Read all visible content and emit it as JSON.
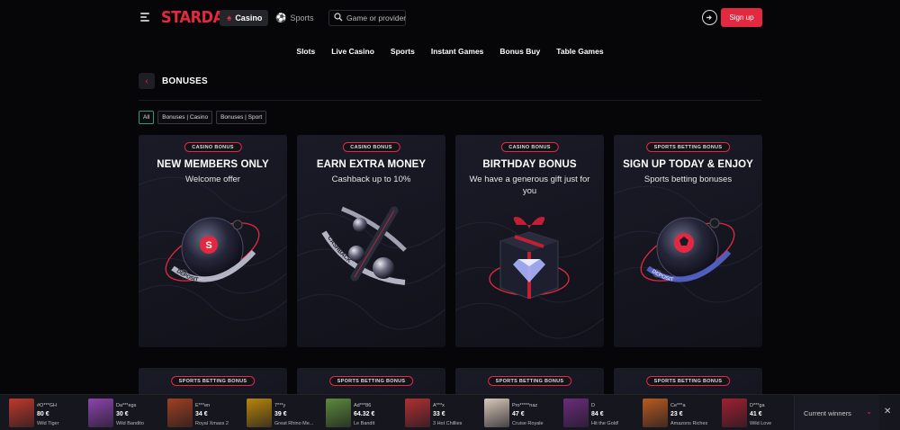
{
  "header": {
    "logo": "STARDA",
    "tabs": [
      {
        "label": "Casino",
        "icon": "spade-icon",
        "active": true
      },
      {
        "label": "Sports",
        "icon": "ball-icon",
        "active": false
      }
    ],
    "search_placeholder": "Game or provider",
    "signup_label": "Sign up"
  },
  "nav": [
    "Slots",
    "Live Casino",
    "Sports",
    "Instant Games",
    "Bonus Buy",
    "Table Games"
  ],
  "page": {
    "title": "BONUSES",
    "filters": [
      {
        "label": "All",
        "active": true
      },
      {
        "label": "Bonuses | Casino",
        "active": false
      },
      {
        "label": "Bonuses | Sport",
        "active": false
      }
    ]
  },
  "cards": [
    {
      "badge": "CASINO BONUS",
      "title": "NEW MEMBERS ONLY",
      "subtitle": "Welcome offer",
      "art_text": "DEPOSIT",
      "art_letter": "S"
    },
    {
      "badge": "CASINO BONUS",
      "title": "EARN EXTRA MONEY",
      "subtitle": "Cashback up to 10%",
      "art_text": "CASHBACK"
    },
    {
      "badge": "CASINO BONUS",
      "title": "BIRTHDAY BONUS",
      "subtitle": "We have a generous gift just for you"
    },
    {
      "badge": "SPORTS BETTING BONUS",
      "title": "SIGN UP TODAY & ENJOY",
      "subtitle": "Sports betting bonuses",
      "art_text": "DEPOSIT"
    }
  ],
  "cards_row2": [
    {
      "badge": "SPORTS BETTING BONUS"
    },
    {
      "badge": "SPORTS BETTING BONUS"
    },
    {
      "badge": "SPORTS BETTING BONUS"
    },
    {
      "badge": "SPORTS BETTING BONUS"
    }
  ],
  "winners": {
    "items": [
      {
        "user": "#O***GH",
        "amount": "80 €",
        "game": "Wild Tiger",
        "color": "#c0392b"
      },
      {
        "user": "Da***egs",
        "amount": "30 €",
        "game": "Wild Bandito",
        "color": "#8e44ad"
      },
      {
        "user": "E***en",
        "amount": "34 €",
        "game": "Royal Xmass 2",
        "color": "#a04020"
      },
      {
        "user": "7***y",
        "amount": "39 €",
        "game": "Great Rhino Me...",
        "color": "#b8860b"
      },
      {
        "user": "Ad***86",
        "amount": "64.32 €",
        "game": "Le Bandit",
        "color": "#5d8a3a"
      },
      {
        "user": "A***x",
        "amount": "33 €",
        "game": "3 Hot Chillies",
        "color": "#b03030"
      },
      {
        "user": "Pro*****naz",
        "amount": "47 €",
        "game": "Cruise Royale",
        "color": "#d8c8b8"
      },
      {
        "user": "D",
        "amount": "84 €",
        "game": "Hit the Gold!",
        "color": "#6b2c7a"
      },
      {
        "user": "Ce***a",
        "amount": "23 €",
        "game": "Amazons Riches",
        "color": "#b85a20"
      },
      {
        "user": "D***ga",
        "amount": "41 €",
        "game": "Wild Love",
        "color": "#a02030"
      }
    ],
    "current_label": "Current winners"
  },
  "colors": {
    "accent": "#e3293f",
    "bg": "#060608",
    "card": "#161722",
    "active_chip": "#2f9c6a"
  }
}
